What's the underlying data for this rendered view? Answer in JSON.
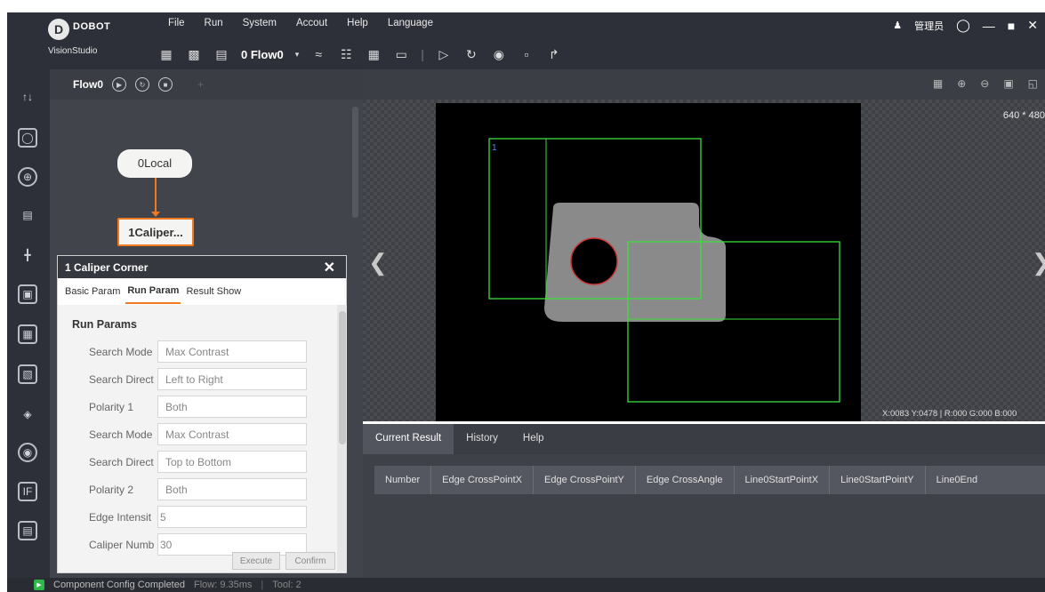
{
  "app": {
    "brand": "DOBOT",
    "product": "VisionStudio",
    "user_label": "管理员"
  },
  "menu": [
    "File",
    "Run",
    "System",
    "Accout",
    "Help",
    "Language"
  ],
  "toolbar": {
    "flow_selector": "0 Flow0"
  },
  "flow_panel": {
    "title": "Flow0",
    "nodes": [
      {
        "label": "0Local"
      },
      {
        "label": "1Caliper..."
      }
    ]
  },
  "dialog": {
    "title": "1 Caliper Corner",
    "tabs": [
      "Basic Param",
      "Run Param",
      "Result Show"
    ],
    "active_tab": "Run Param",
    "section": "Run Params",
    "params": [
      {
        "label": "Search Mode",
        "value": "Max Contrast"
      },
      {
        "label": "Search Direct",
        "value": "Left to Right"
      },
      {
        "label": "Polarity 1",
        "value": "Both"
      },
      {
        "label": "Search Mode",
        "value": "Max Contrast"
      },
      {
        "label": "Search Direct",
        "value": "Top to Bottom"
      },
      {
        "label": "Polarity 2",
        "value": "Both"
      },
      {
        "label": "Edge Intensit",
        "value": "5"
      },
      {
        "label": "Caliper Numb",
        "value": "30"
      }
    ],
    "execute_label": "Execute",
    "confirm_label": "Confirm"
  },
  "viewer": {
    "resolution": "640 * 480",
    "roi_label": "1",
    "coord_readout": "X:0083 Y:0478 | R:000 G:000 B:000"
  },
  "results": {
    "tabs": [
      "Current Result",
      "History",
      "Help"
    ],
    "active_tab": "Current Result",
    "columns": [
      "Number",
      "Edge CrossPointX",
      "Edge CrossPointY",
      "Edge CrossAngle",
      "Line0StartPointX",
      "Line0StartPointY",
      "Line0End"
    ]
  },
  "status": {
    "message": "Component Config Completed",
    "flow_time": "Flow: 9.35ms",
    "tool_time": "Tool: 2"
  },
  "colors": {
    "accent": "#f07a22",
    "roi": "#3cdc3c",
    "dark_bg": "#2d3038"
  }
}
